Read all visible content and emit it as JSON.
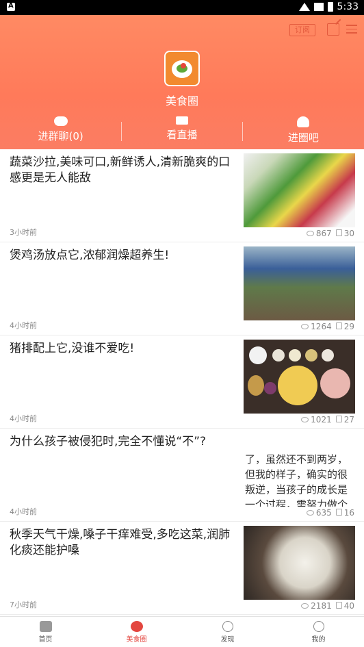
{
  "status_bar": {
    "time": "5:33"
  },
  "header": {
    "subscribe_label": "订阅",
    "circle_name": "美食圈",
    "actions": [
      {
        "label": "进群聊(0)",
        "icon": "chat-icon"
      },
      {
        "label": "看直播",
        "icon": "video-icon"
      },
      {
        "label": "进圈吧",
        "icon": "group-icon"
      }
    ]
  },
  "feed": [
    {
      "title": "蔬菜沙拉,美味可口,新鲜诱人,清新脆爽的口感更是无人能敌",
      "time": "3小时前",
      "views": "867",
      "likes": "30"
    },
    {
      "title": "煲鸡汤放点它,浓郁润燥超养生!",
      "time": "4小时前",
      "views": "1264",
      "likes": "29"
    },
    {
      "title": "猪排配上它,没谁不爱吃!",
      "time": "4小时前",
      "views": "1021",
      "likes": "27"
    },
    {
      "title": "为什么孩子被侵犯时,完全不懂说“不”?",
      "time": "4小时前",
      "views": "635",
      "likes": "16",
      "thumb_text": "了，虽然还不到两岁，但我的样子，确实的很叛逆，当孩子的成长是一个过程，需努力做个称职的妈妈吧！"
    },
    {
      "title": "秋季天气干燥,嗓子干痒难受,多吃这菜,润肺化痰还能护嗓",
      "time": "7小时前",
      "views": "2181",
      "likes": "40"
    }
  ],
  "tabbar": {
    "tabs": [
      {
        "label": "首页",
        "icon": "home-icon"
      },
      {
        "label": "美食圈",
        "icon": "share-circle-icon",
        "active": true
      },
      {
        "label": "发现",
        "icon": "compass-icon"
      },
      {
        "label": "我的",
        "icon": "user-icon"
      }
    ]
  }
}
